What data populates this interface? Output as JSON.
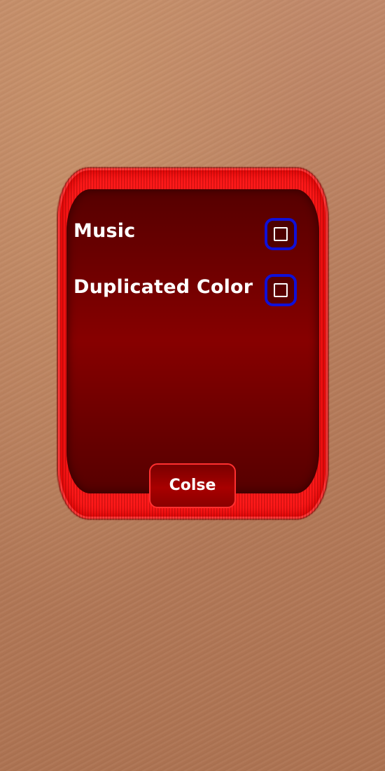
{
  "settings": {
    "items": [
      {
        "label": "Music",
        "checked": false
      },
      {
        "label": "Duplicated Color",
        "checked": false
      }
    ],
    "close_label": "Colse"
  },
  "colors": {
    "background": "#b67c5b",
    "frame": "#ff1a1a",
    "panel": "#870000",
    "checkbox_border": "#1010d8",
    "text": "#ffffff"
  }
}
